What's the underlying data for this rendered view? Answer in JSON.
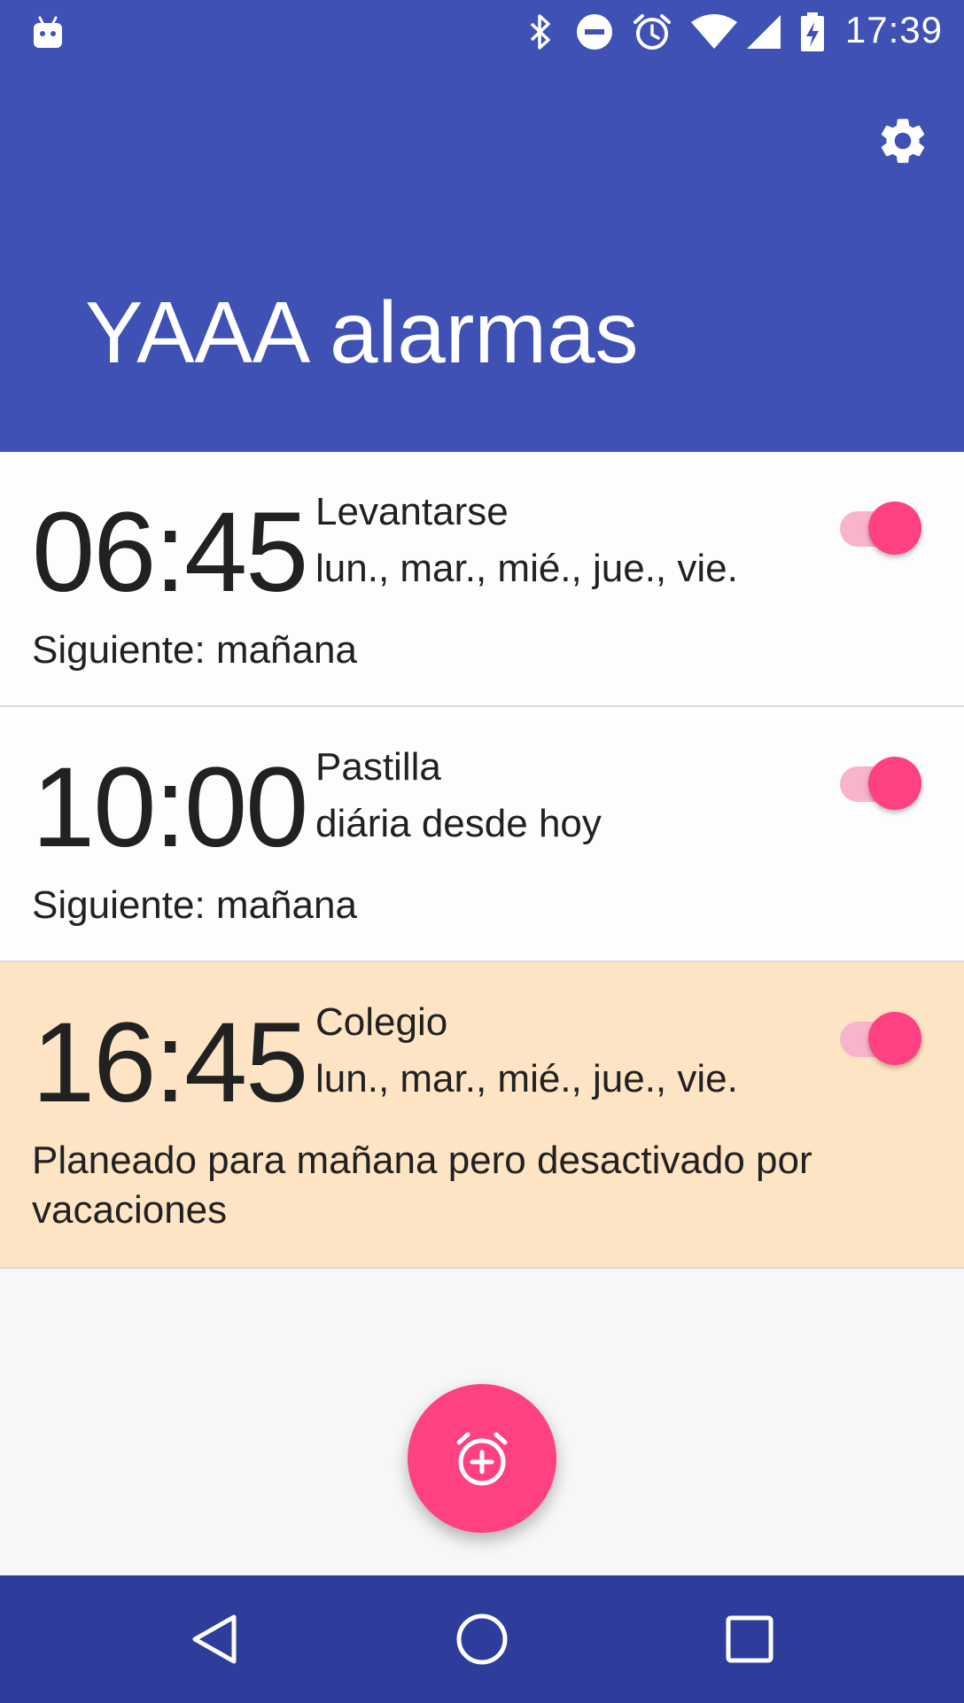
{
  "app": {
    "title": "YAAA alarmas"
  },
  "status_bar": {
    "time": "17:39",
    "icons": [
      "android-icon",
      "bluetooth-icon",
      "do-not-disturb-icon",
      "alarm-icon",
      "wifi-icon",
      "signal-icon",
      "battery-charging-icon"
    ]
  },
  "toolbar": {
    "settings_icon": "gear-icon"
  },
  "alarms": [
    {
      "time": "06:45",
      "label": "Levantarse",
      "days": "lun., mar., mié., jue., vie.",
      "next": "Siguiente: mañana",
      "enabled": true
    },
    {
      "time": "10:00",
      "label": "Pastilla",
      "days": "diária desde hoy",
      "next": "Siguiente: mañana",
      "enabled": true
    },
    {
      "time": "16:45",
      "label": "Colegio",
      "days": "lun., mar., mié., jue., vie.",
      "next": "Planeado para mañana pero desactivado por vacaciones",
      "enabled": true,
      "highlight_color": "#FDE4C4"
    }
  ],
  "fab": {
    "icon": "add-alarm-icon"
  },
  "nav": {
    "icons": [
      "back-icon",
      "home-icon",
      "recents-icon"
    ]
  },
  "colors": {
    "primary": "#3F51B5",
    "primary_dark": "#2E3D9B",
    "accent": "#FF4081",
    "vacation_highlight": "#FDE4C4"
  }
}
